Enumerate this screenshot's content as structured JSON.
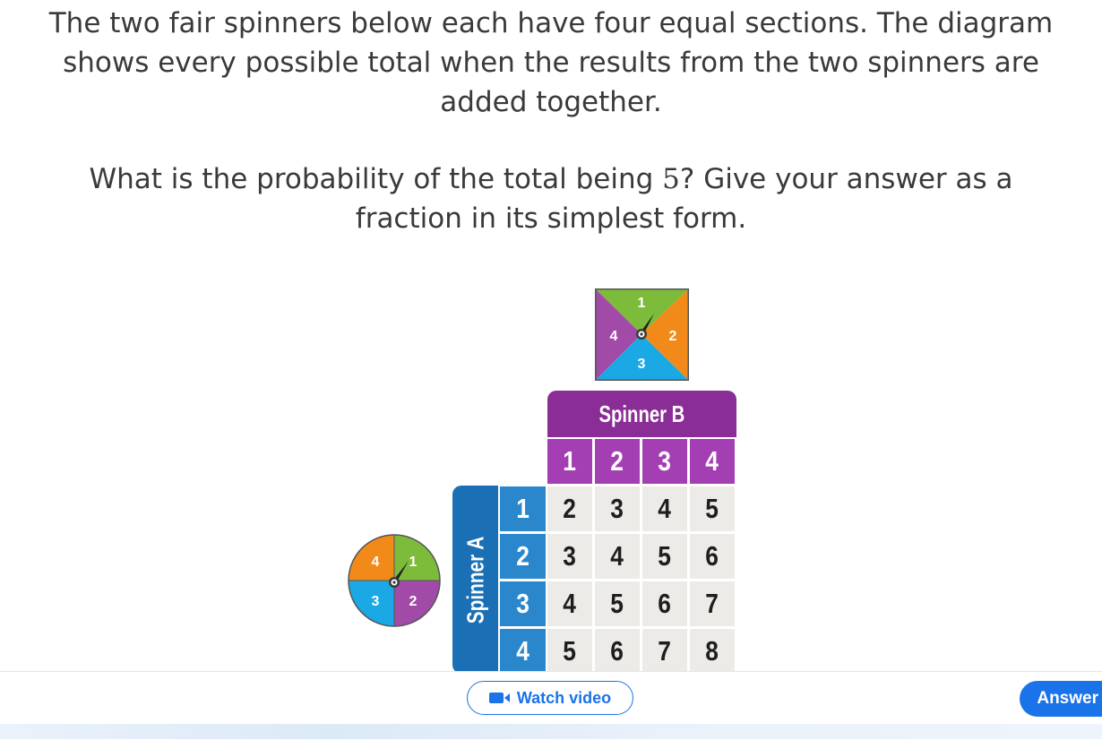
{
  "question": {
    "line1": "The two fair spinners below each have four equal sections. The diagram shows every possible total when the results from the two spinners are added together.",
    "line2_before": "What is the probability of the total being ",
    "line2_number": "5",
    "line2_after": "? Give your answer as a fraction in its simplest form."
  },
  "spinner_b": {
    "labels": [
      "1",
      "2",
      "3",
      "4"
    ],
    "colors": {
      "top": "#7dbb3b",
      "right": "#f28a1a",
      "bottom": "#1aa9e4",
      "left": "#a24aa8"
    }
  },
  "spinner_a": {
    "labels": [
      "1",
      "2",
      "3",
      "4"
    ],
    "colors": {
      "top_right": "#7dbb3b",
      "bottom_right": "#a24aa8",
      "bottom_left": "#1aa9e4",
      "top_left": "#f28a1a"
    }
  },
  "table": {
    "spinner_b_label": "Spinner B",
    "spinner_a_label": "Spinner A",
    "b_values": [
      "1",
      "2",
      "3",
      "4"
    ],
    "a_values": [
      "1",
      "2",
      "3",
      "4"
    ],
    "totals": [
      [
        "2",
        "3",
        "4",
        "5"
      ],
      [
        "3",
        "4",
        "5",
        "6"
      ],
      [
        "4",
        "5",
        "6",
        "7"
      ],
      [
        "5",
        "6",
        "7",
        "8"
      ]
    ]
  },
  "footer": {
    "watch_video_label": "Watch video",
    "answer_label": "Answer"
  },
  "colors": {
    "purple_header": "#8b2d96",
    "purple_cell": "#a33fb3",
    "blue_header": "#1a6fb5",
    "blue_cell": "#2b87cc",
    "grid_cell": "#ecebe7",
    "accent_blue": "#1a73e8"
  }
}
